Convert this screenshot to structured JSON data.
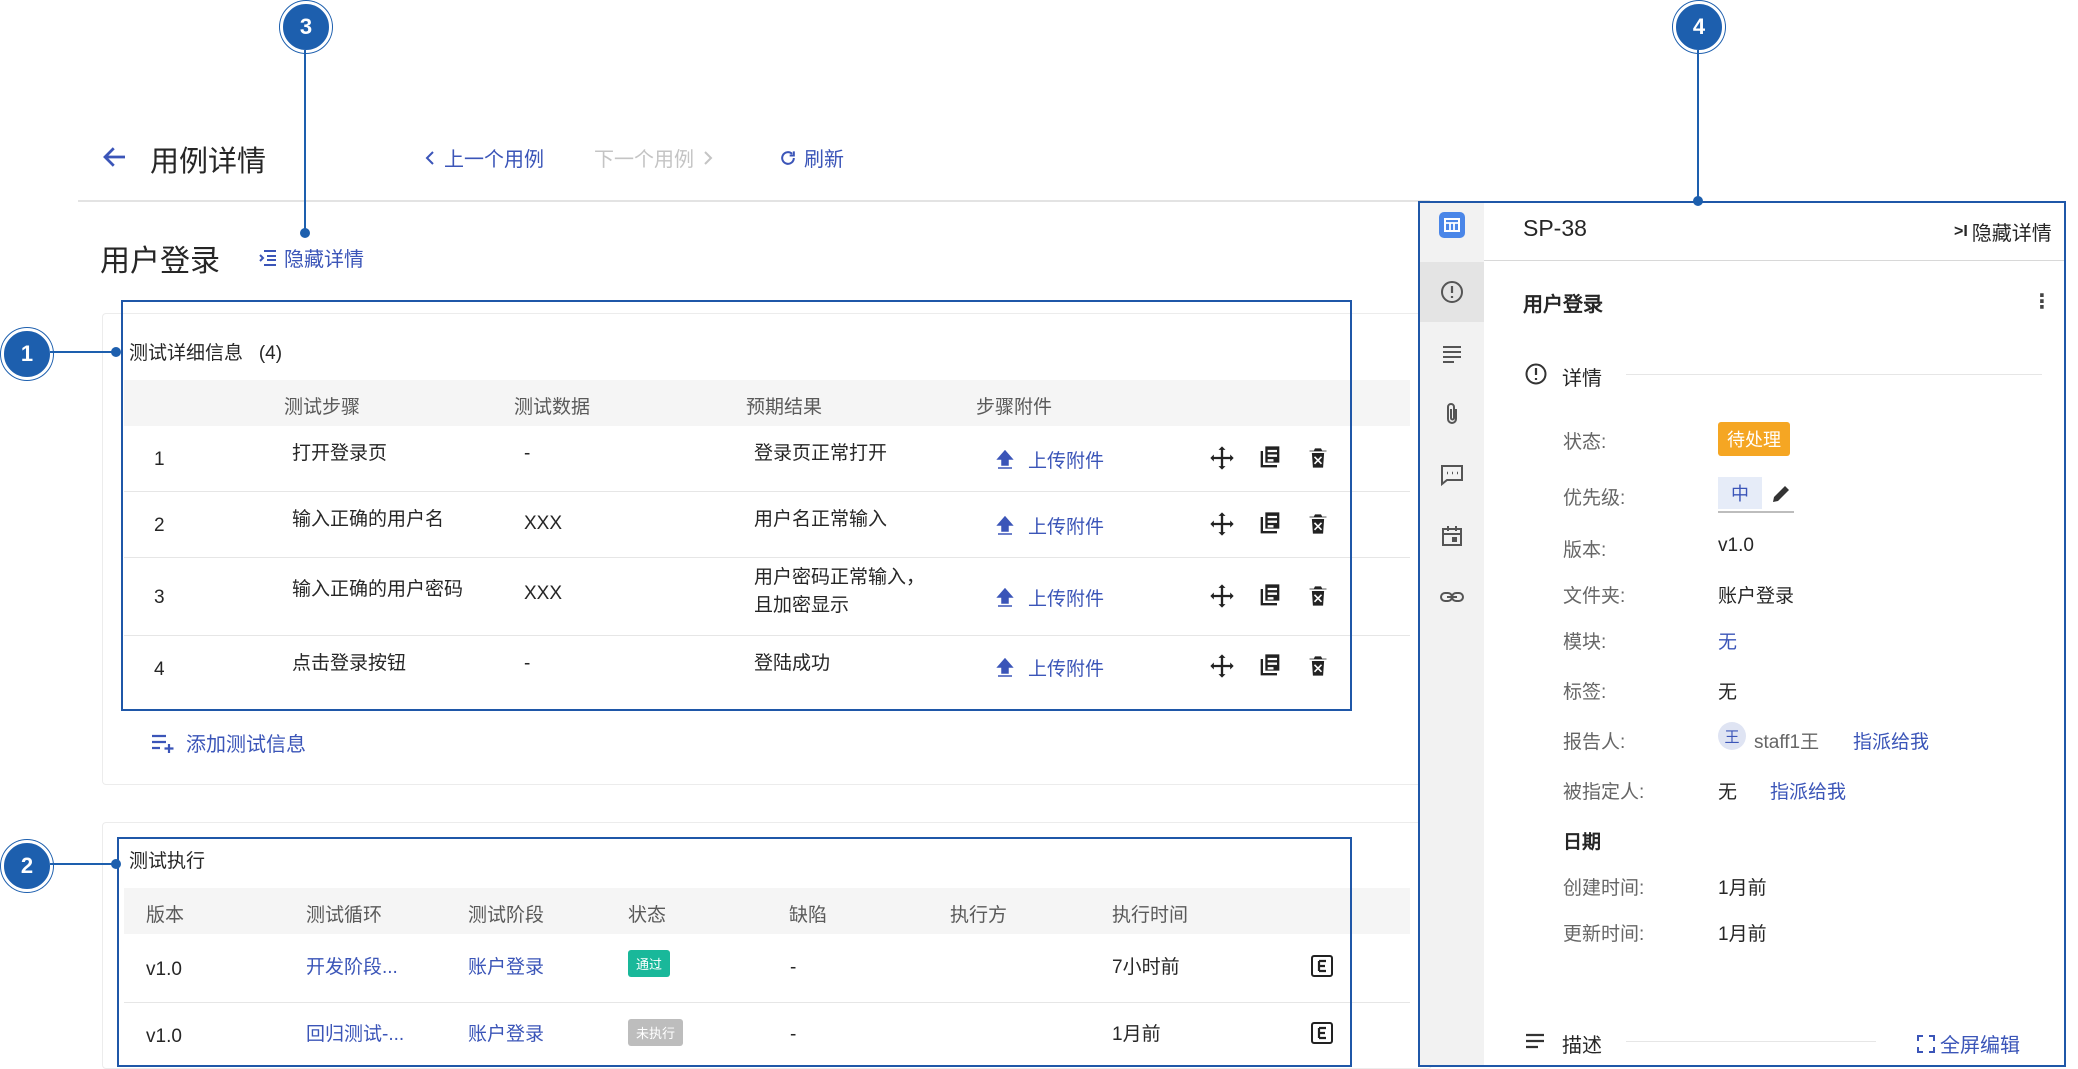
{
  "header": {
    "title": "用例详情",
    "prev_case": "上一个用例",
    "next_case": "下一个用例",
    "refresh": "刷新"
  },
  "case": {
    "title": "用户登录",
    "hide_details": "隐藏详情"
  },
  "test_details": {
    "title": "测试详细信息",
    "count": "(4)",
    "columns": [
      "测试步骤",
      "测试数据",
      "预期结果",
      "步骤附件"
    ],
    "upload_label": "上传附件",
    "rows": [
      {
        "no": "1",
        "step": "打开登录页",
        "data": "-",
        "expected": "登录页正常打开",
        "expected2": ""
      },
      {
        "no": "2",
        "step": "输入正确的用户名",
        "data": "XXX",
        "expected": "用户名正常输入",
        "expected2": ""
      },
      {
        "no": "3",
        "step": "输入正确的用户密码",
        "data": "XXX",
        "expected": "用户密码正常输入，",
        "expected2": "且加密显示"
      },
      {
        "no": "4",
        "step": "点击登录按钮",
        "data": "-",
        "expected": "登陆成功",
        "expected2": ""
      }
    ],
    "add_label": "添加测试信息"
  },
  "executions": {
    "title": "测试执行",
    "columns": [
      "版本",
      "测试循环",
      "测试阶段",
      "状态",
      "缺陷",
      "执行方",
      "执行时间"
    ],
    "rows": [
      {
        "version": "v1.0",
        "cycle": "开发阶段...",
        "stage": "账户登录",
        "status": "通过",
        "status_color": "#19b89a",
        "defect": "-",
        "executor": "",
        "time": "7小时前"
      },
      {
        "version": "v1.0",
        "cycle": "回归测试-...",
        "stage": "账户登录",
        "status": "未执行",
        "status_color": "#bdbdbd",
        "defect": "-",
        "executor": "",
        "time": "1月前"
      }
    ]
  },
  "panel": {
    "issue_key": "SP-38",
    "hide_details": "隐藏详情",
    "case_title": "用户登录",
    "details_heading": "详情",
    "props": {
      "status_label": "状态:",
      "status_value": "待处理",
      "status_color": "#f5a623",
      "priority_label": "优先级:",
      "priority_value": "中",
      "version_label": "版本:",
      "version_value": "v1.0",
      "folder_label": "文件夹:",
      "folder_value": "账户登录",
      "module_label": "模块:",
      "module_value": "无",
      "tag_label": "标签:",
      "tag_value": "无",
      "reporter_label": "报告人:",
      "reporter_avatar": "王",
      "reporter_value": "staff1王",
      "reporter_assign": "指派给我",
      "assignee_label": "被指定人:",
      "assignee_value": "无",
      "assignee_assign": "指派给我"
    },
    "date_heading": "日期",
    "created_label": "创建时间:",
    "created_value": "1月前",
    "updated_label": "更新时间:",
    "updated_value": "1月前",
    "description_heading": "描述",
    "fullscreen_edit": "全屏编辑"
  },
  "annotations": [
    "1",
    "2",
    "3",
    "4"
  ],
  "colors": {
    "accent": "#3b55b8",
    "annotation": "#1d5fae"
  }
}
